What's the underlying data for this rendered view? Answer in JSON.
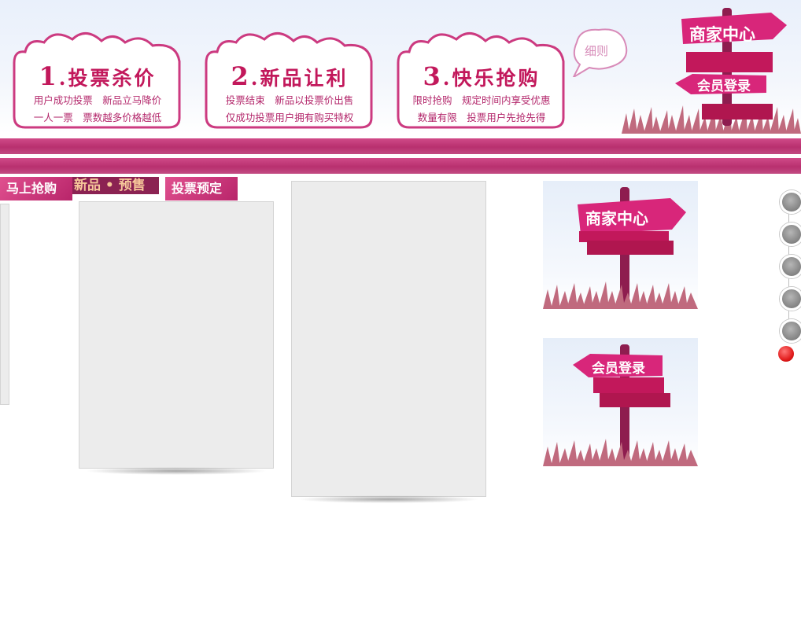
{
  "steps": [
    {
      "number": "1",
      "title": ".投票杀价",
      "line1": "用户成功投票　新品立马降价",
      "line2": "一人一票　票数越多价格越低"
    },
    {
      "number": "2",
      "title": ".新品让利",
      "line1": "投票结束　新品以投票价出售",
      "line2": "仅成功投票用户拥有购买特权"
    },
    {
      "number": "3",
      "title": ".快乐抢购",
      "line1": "限时抢购　规定时间内享受优惠",
      "line2": "数量有限　投票用户先抢先得"
    }
  ],
  "rules_bubble": "细则",
  "signs": {
    "merchant_center": "商家中心",
    "member_login": "会员登录"
  },
  "tabs": {
    "buy_now": "马上抢购",
    "new_presale": "新品 • 预售",
    "vote_reserve": "投票预定"
  },
  "colors": {
    "brand_pink": "#c2185b",
    "bar_pink": "#c13a7b",
    "active_dot": "#e21d1d",
    "inactive_dot": "#9a9a9a"
  },
  "carousel": {
    "total_dots": 6,
    "active_index": 5
  }
}
